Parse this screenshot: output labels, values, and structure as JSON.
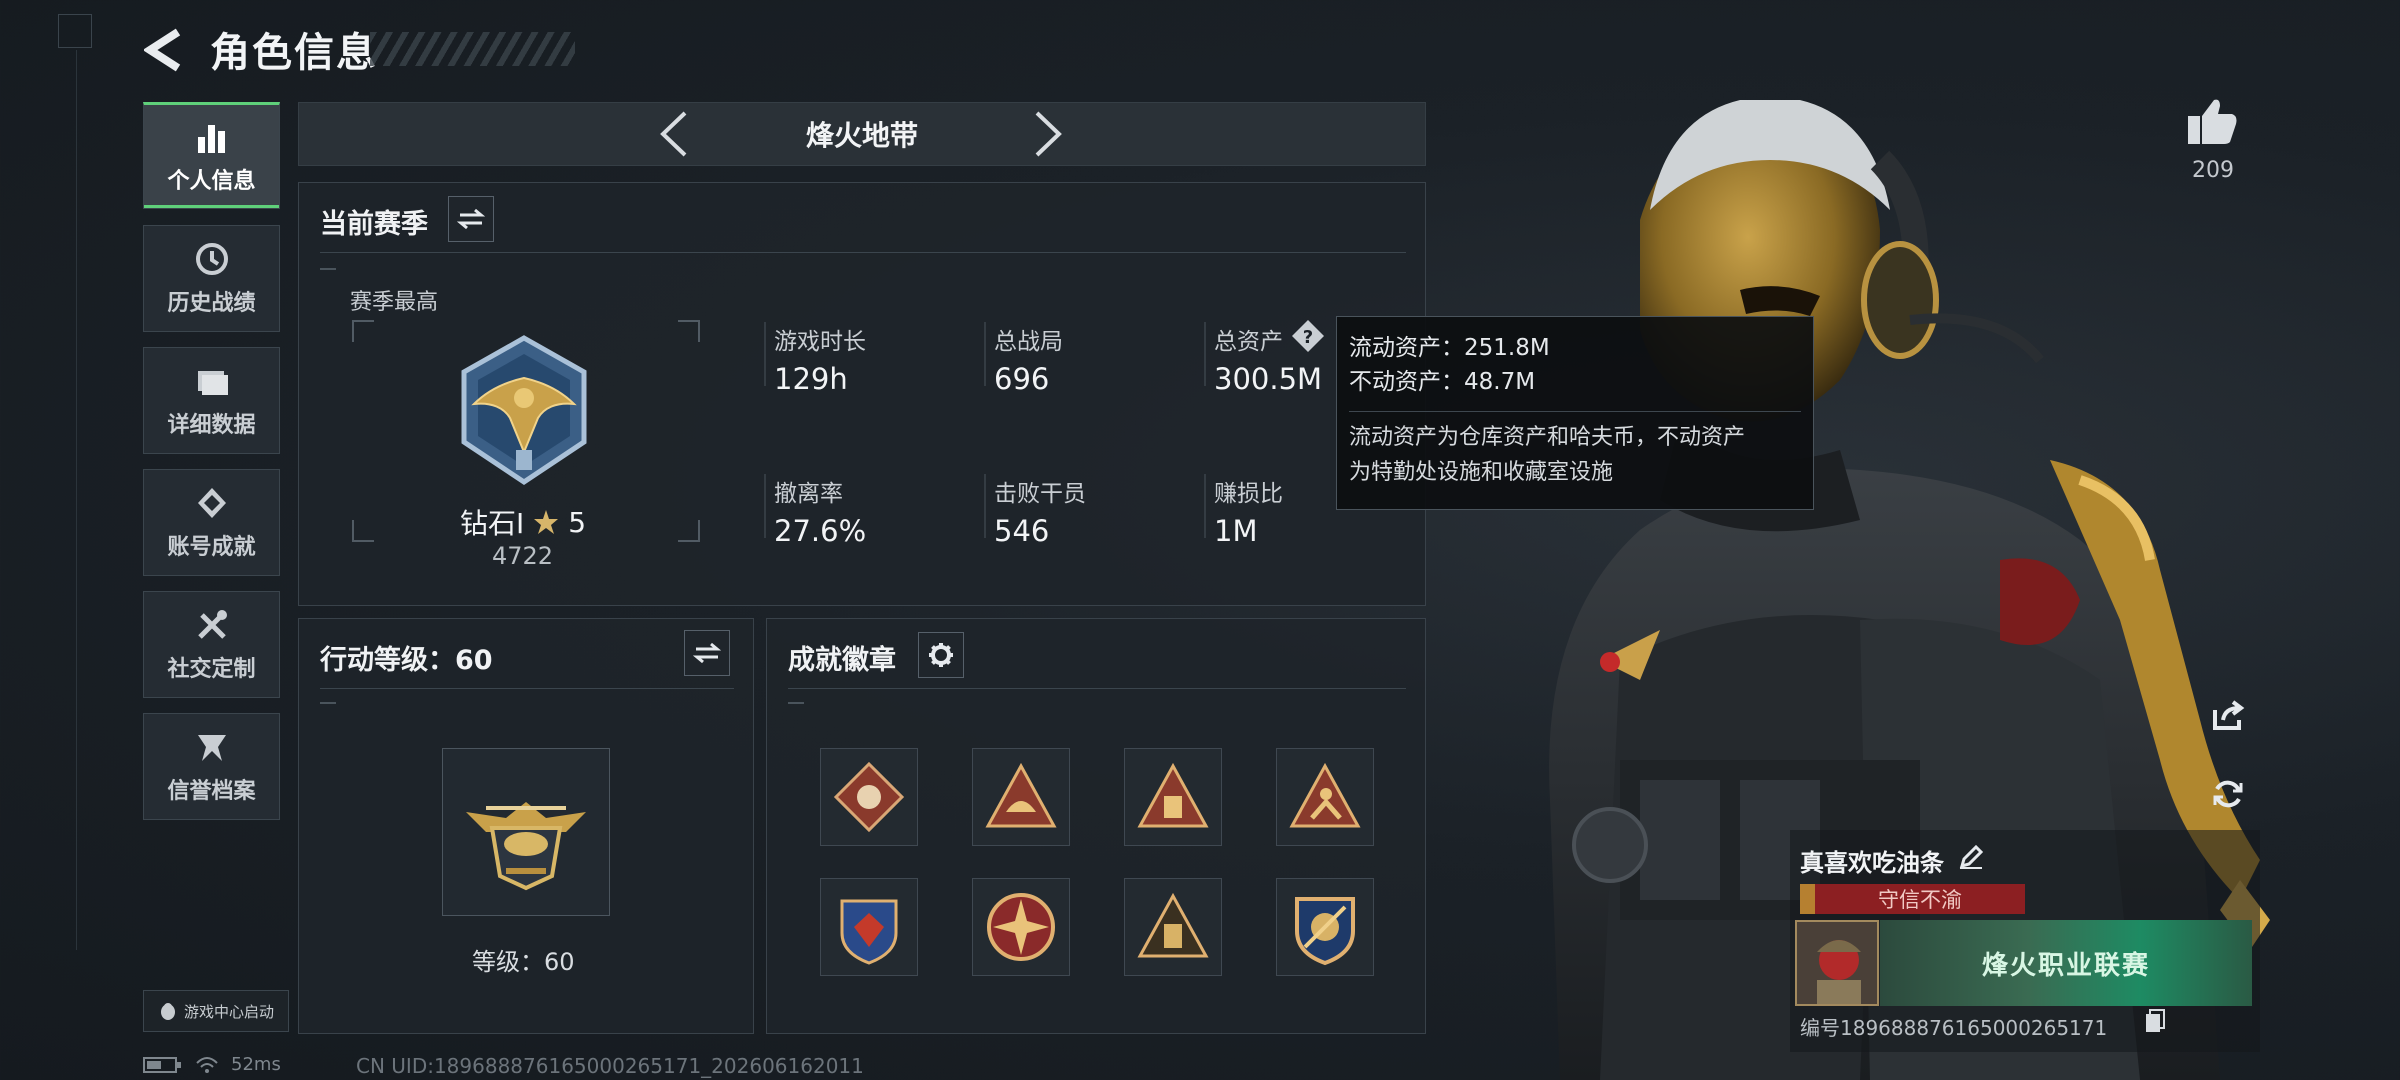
{
  "header": {
    "title": "角色信息"
  },
  "sidebar": {
    "items": [
      {
        "label": "个人信息",
        "icon": "bar-chart-icon",
        "active": true
      },
      {
        "label": "历史战绩",
        "icon": "clock-history-icon",
        "active": false
      },
      {
        "label": "详细数据",
        "icon": "folder-icon",
        "active": false
      },
      {
        "label": "账号成就",
        "icon": "achievement-icon",
        "active": false
      },
      {
        "label": "社交定制",
        "icon": "tools-icon",
        "active": false
      },
      {
        "label": "信誉档案",
        "icon": "credit-icon",
        "active": false
      }
    ]
  },
  "mode": {
    "title": "烽火地带"
  },
  "season": {
    "title": "当前赛季",
    "best_label": "赛季最高",
    "rank_name": "钻石I",
    "rank_stars": "5",
    "rank_points": "4722",
    "stats": [
      {
        "label": "游戏时长",
        "value": "129h"
      },
      {
        "label": "总战局",
        "value": "696"
      },
      {
        "label": "总资产",
        "value": "300.5M"
      },
      {
        "label": "撤离率",
        "value": "27.6%"
      },
      {
        "label": "击败干员",
        "value": "546"
      },
      {
        "label": "赚损比",
        "value": "1M"
      }
    ]
  },
  "tooltip": {
    "line1": "流动资产：251.8M",
    "line2": "不动资产：48.7M",
    "desc1": "流动资产为仓库资产和哈夫币，不动资产",
    "desc2": "为特勤处设施和收藏室设施"
  },
  "action": {
    "title": "行动等级：60",
    "level_label": "等级：60"
  },
  "badges": {
    "title": "成就徽章"
  },
  "player": {
    "likes": "209",
    "name": "真喜欢吃油条",
    "honor": "守信不渝",
    "banner_text": "烽火职业联赛",
    "uid_line": "编号18968887616500026517​1"
  },
  "footer": {
    "launch": "游戏中心启动",
    "ping": "52ms",
    "cn_uid": "CN UID:18968887616500026517​1_202606162011"
  },
  "colors": {
    "accent": "#5fd07a",
    "honor_red": "#8c1f22",
    "gold": "#c9a14a"
  }
}
